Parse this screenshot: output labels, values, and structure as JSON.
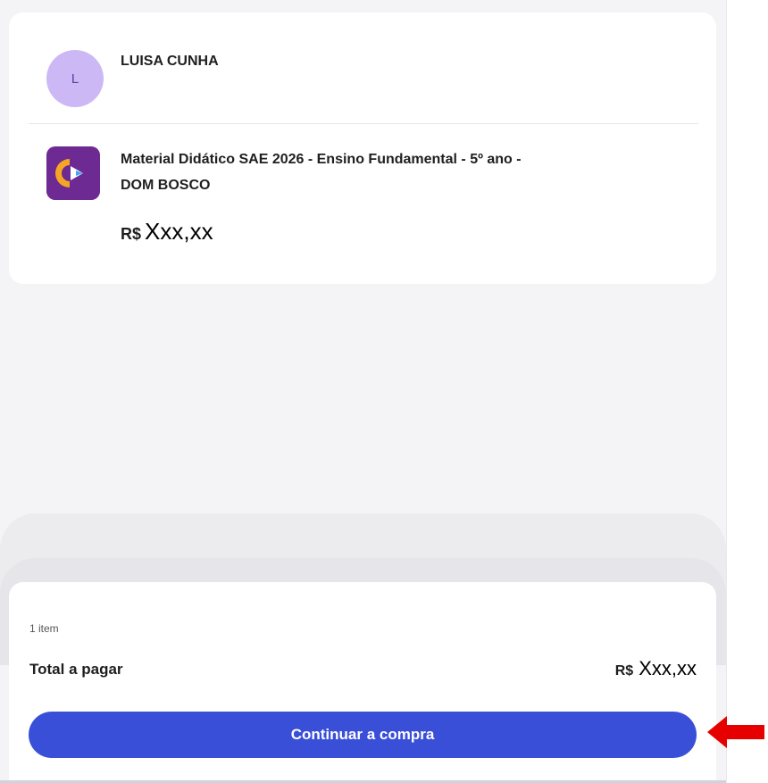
{
  "customer": {
    "avatar_initial": "L",
    "name": "LUISA CUNHA"
  },
  "product": {
    "logo_icon": "sae-digital-logo-icon",
    "title_line1": "Material Didático SAE 2026 - Ensino Fundamental - 5º ano -",
    "title_line2": "DOM BOSCO",
    "currency": "R$",
    "price": "Xxx,xx"
  },
  "summary": {
    "item_count": "1 item",
    "total_label": "Total a pagar",
    "currency": "R$",
    "total": "Xxx,xx"
  },
  "cta": {
    "label": "Continuar a compra",
    "color": "#3a4fd8"
  },
  "annotation": {
    "arrow_icon": "red-arrow-left-icon",
    "color": "#e60000"
  }
}
